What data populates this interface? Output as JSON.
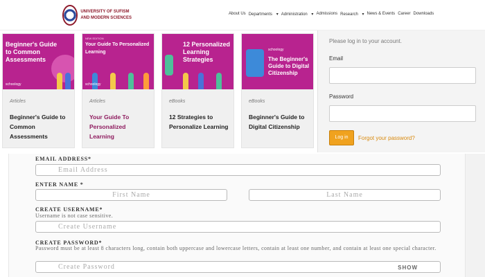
{
  "header": {
    "logo_line1": "UNIVERSITY OF SUFISM",
    "logo_line2": "AND MODERN SCIENCES",
    "nav": [
      "About Us",
      "Departments",
      "Administration",
      "Admissions",
      "Research",
      "News & Events",
      "Career",
      "Downloads"
    ]
  },
  "cards": [
    {
      "image_title": "Beginner's Guide to Common Assessments",
      "image_brand": "schoology",
      "category": "Articles",
      "title": "Beginner's Guide to Common Assessments",
      "active": false
    },
    {
      "image_title": "Your Guide To Personalized Learning",
      "image_sub": "NEW EDITION",
      "image_brand": "schoology",
      "category": "Articles",
      "title": "Your Guide To Personalized Learning",
      "active": true
    },
    {
      "image_title": "12 Personalized Learning Strategies",
      "image_brand": "",
      "category": "eBooks",
      "title": "12 Strategies to Personalize Learning",
      "active": false
    },
    {
      "image_title": "The Beginner's Guide to Digital Citizenship",
      "image_brand": "schoology",
      "category": "eBooks",
      "title": "Beginner's Guide to Digital Citizenship",
      "active": false
    }
  ],
  "login": {
    "prompt": "Please log in to your account.",
    "email_label": "Email",
    "password_label": "Password",
    "button_label": "Log in",
    "forgot_label": "Forgot your password?"
  },
  "form": {
    "email_label": "EMAIL ADDRESS*",
    "email_placeholder": "Email Address",
    "name_label": "ENTER NAME *",
    "first_placeholder": "First Name",
    "last_placeholder": "Last Name",
    "username_label": "CREATE USERNAME*",
    "username_note": "Username is not case sensitive.",
    "username_placeholder": "Create Username",
    "password_label": "CREATE PASSWORD*",
    "password_note": "Password must be at least 8 characters long, contain both uppercase and lowercase letters, contain at least one number, and contain at least one special character.",
    "password_placeholder": "Create Password",
    "show_label": "SHOW"
  },
  "colors": {
    "accent": "#b8238f",
    "brand": "#8e1b2c",
    "login_button": "#f0a21f"
  }
}
